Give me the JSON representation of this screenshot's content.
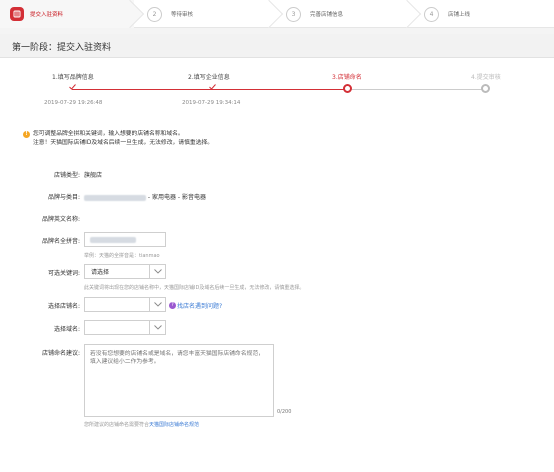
{
  "top_steps": [
    {
      "num": "",
      "label": "提交入驻资料"
    },
    {
      "num": "2",
      "label": "等待审核"
    },
    {
      "num": "3",
      "label": "完善店铺信息"
    },
    {
      "num": "4",
      "label": "店铺上线"
    }
  ],
  "page_title": "第一阶段：提交入驻资料",
  "progress": {
    "steps": [
      {
        "label": "1.填写品牌信息",
        "date": "2019-07-29 19:26:48",
        "state": "done"
      },
      {
        "label": "2.填写企业信息",
        "date": "2019-07-29 19:34:14",
        "state": "done"
      },
      {
        "label": "3.店铺命名",
        "date": "",
        "state": "current"
      },
      {
        "label": "4.提交审核",
        "date": "",
        "state": "todo"
      }
    ]
  },
  "notice": {
    "line1": "您可调整品牌全拼和关键词，输入想要的店铺名称和域名。",
    "line2": "注意！天猫国际店铺ID及域名后续一旦生成，无法修改，请慎重选择。"
  },
  "form": {
    "shop_type_label": "店铺类型:",
    "shop_type_value": "旗舰店",
    "brand_category_label": "品牌与类目:",
    "brand_category_suffix": "- 家用电器 - 影音电器",
    "brand_en_label": "品牌英文名称:",
    "brand_pinyin_label": "品牌名全拼音:",
    "brand_pinyin_hint": "举例：天猫的全拼音是：tianmao",
    "keyword_label": "可选关键词:",
    "keyword_value": "请选择",
    "keyword_hint": "此关键词将出现在您的店铺名称中，天猫国际店铺ID及域名后续一旦生成，无法修改，请慎重选择。",
    "shop_name_label": "选择店铺名:",
    "shop_name_help": "找店名遇到问题?",
    "domain_label": "选择域名:",
    "suggest_label": "店铺命名建议:",
    "suggest_placeholder": "若没有您想要的店铺名或是域名，请您丰富天猫国际店铺命名规范，填入建议给小二作为参考。",
    "counter": "0/200",
    "footer_text": "您所建议的店铺命名需要符合",
    "footer_link": "天猫国际店铺命名规范"
  },
  "colors": {
    "accent": "#d32f36",
    "link": "#3b7bd4",
    "warning": "#f5a623"
  }
}
